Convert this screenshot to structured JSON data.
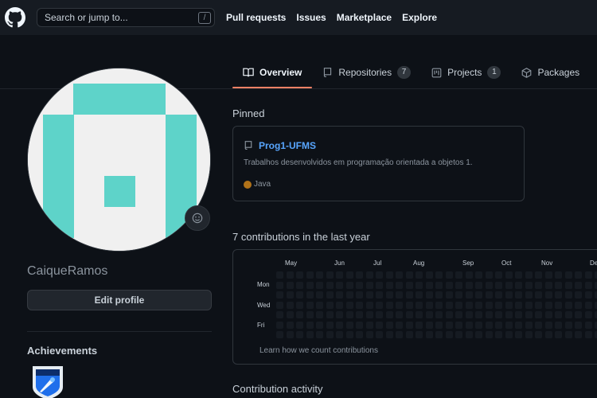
{
  "header": {
    "search_placeholder": "Search or jump to...",
    "search_shortcut": "/",
    "nav": [
      "Pull requests",
      "Issues",
      "Marketplace",
      "Explore"
    ]
  },
  "tabs": [
    {
      "label": "Overview",
      "active": true,
      "icon": "book-icon"
    },
    {
      "label": "Repositories",
      "count": "7",
      "icon": "repo-icon"
    },
    {
      "label": "Projects",
      "count": "1",
      "icon": "project-icon"
    },
    {
      "label": "Packages",
      "icon": "package-icon"
    }
  ],
  "profile": {
    "username": "CaiqueRamos",
    "edit_label": "Edit profile",
    "achievements_title": "Achievements",
    "avatar_color": "#5ed3c9"
  },
  "pinned": {
    "title": "Pinned",
    "repo": {
      "name": "Prog1-UFMS",
      "description": "Trabalhos desenvolvidos em programação orientada a objetos 1.",
      "language": "Java",
      "language_color": "#b07219"
    }
  },
  "contributions": {
    "title": "7 contributions in the last year",
    "months": [
      "May",
      "Jun",
      "Jul",
      "Aug",
      "Sep",
      "Oct",
      "Nov",
      "Dec"
    ],
    "days": [
      "Mon",
      "Wed",
      "Fri"
    ],
    "learn_link": "Learn how we count contributions"
  },
  "activity": {
    "title": "Contribution activity"
  },
  "colors": {
    "background": "#0d1117",
    "header": "#161b22",
    "accent_tab": "#f78166",
    "link": "#58a6ff"
  }
}
